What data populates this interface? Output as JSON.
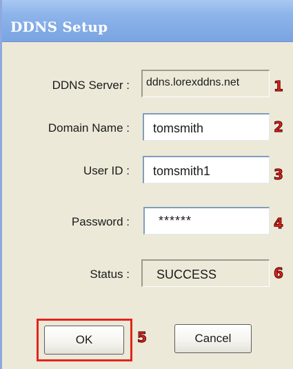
{
  "window": {
    "title": "DDNS Setup"
  },
  "form": {
    "ddns_server": {
      "label": "DDNS Server :",
      "value": "ddns.lorexddns.net",
      "marker": "1"
    },
    "domain_name": {
      "label": "Domain Name :",
      "value": "tomsmith",
      "marker": "2"
    },
    "user_id": {
      "label": "User ID :",
      "value": "tomsmith1",
      "marker": "3"
    },
    "password": {
      "label": "Password :",
      "value": "******",
      "marker": "4"
    },
    "status": {
      "label": "Status :",
      "value": "SUCCESS",
      "marker": "6"
    }
  },
  "buttons": {
    "ok_label": "OK",
    "ok_marker": "5",
    "cancel_label": "Cancel"
  },
  "colors": {
    "annotation": "#e3231d",
    "titlebar": "#8db4ea",
    "dialog_face": "#ece9d8"
  }
}
